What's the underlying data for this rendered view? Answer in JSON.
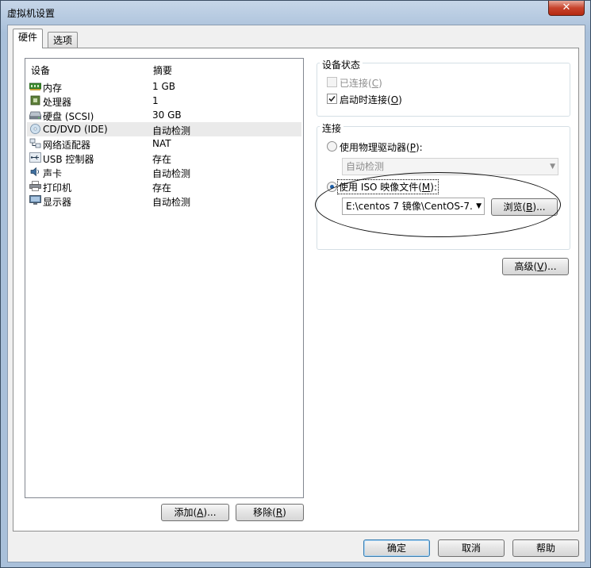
{
  "window": {
    "title": "虚拟机设置",
    "close_label": "✕"
  },
  "tabs": [
    {
      "label": "硬件"
    },
    {
      "label": "选项"
    }
  ],
  "device_list": {
    "headers": {
      "device": "设备",
      "summary": "摘要"
    },
    "rows": [
      {
        "name": "内存",
        "value": "1 GB",
        "icon": "memory-icon"
      },
      {
        "name": "处理器",
        "value": "1",
        "icon": "processor-icon"
      },
      {
        "name": "硬盘 (SCSI)",
        "value": "30 GB",
        "icon": "hard-disk-icon"
      },
      {
        "name": "CD/DVD (IDE)",
        "value": "自动检测",
        "icon": "cd-dvd-icon"
      },
      {
        "name": "网络适配器",
        "value": "NAT",
        "icon": "network-adapter-icon"
      },
      {
        "name": "USB 控制器",
        "value": "存在",
        "icon": "usb-icon"
      },
      {
        "name": "声卡",
        "value": "自动检测",
        "icon": "sound-card-icon"
      },
      {
        "name": "打印机",
        "value": "存在",
        "icon": "printer-icon"
      },
      {
        "name": "显示器",
        "value": "自动检测",
        "icon": "display-icon"
      }
    ],
    "selected_index": 3
  },
  "buttons": {
    "add": {
      "text": "添加(",
      "key": "A",
      "tail": ")..."
    },
    "remove": {
      "text": "移除(",
      "key": "R",
      "tail": ")"
    },
    "browse": {
      "text": "浏览(",
      "key": "B",
      "tail": ")..."
    },
    "advanced": {
      "text": "高级(",
      "key": "V",
      "tail": ")..."
    },
    "ok": "确定",
    "cancel": "取消",
    "help": "帮助"
  },
  "device_status": {
    "title": "设备状态",
    "connected": {
      "text": "已连接(",
      "key": "C",
      "tail": ")",
      "checked": false,
      "enabled": false
    },
    "connect_at_power_on": {
      "text": "启动时连接(",
      "key": "O",
      "tail": ")",
      "checked": true
    }
  },
  "connection": {
    "title": "连接",
    "physical": {
      "text": "使用物理驱动器(",
      "key": "P",
      "tail": "):",
      "selected": false
    },
    "physical_drive_value": "自动检测",
    "iso": {
      "text": "使用 ISO 映像文件(",
      "key": "M",
      "tail": "):",
      "selected": true
    },
    "iso_path_value": "E:\\centos 7 镜像\\CentOS-7."
  },
  "colors": {
    "selection": "#eaeaea",
    "default_button_border": "#3c7fb1",
    "close_red": "#c7432c"
  }
}
